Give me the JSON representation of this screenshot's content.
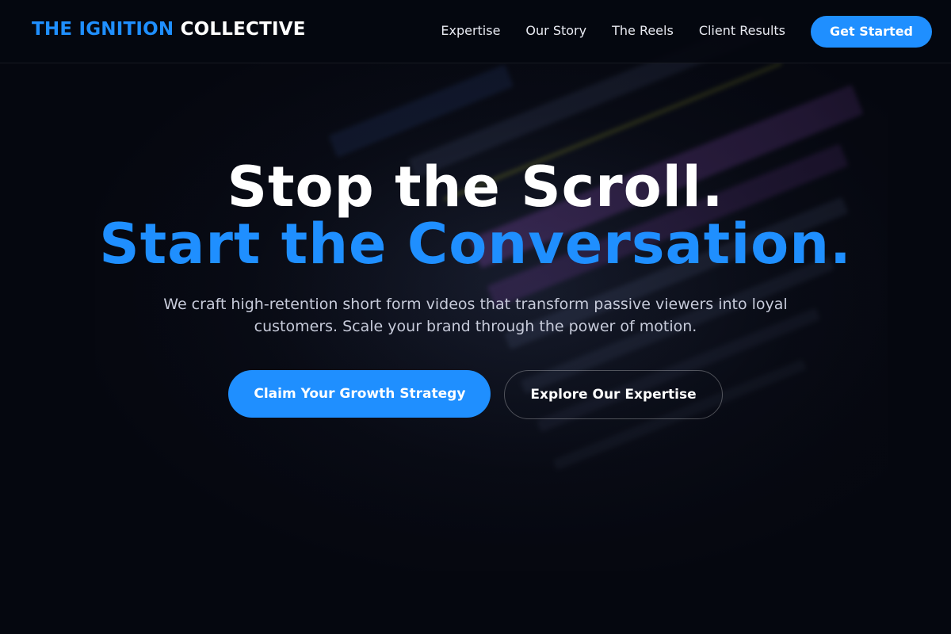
{
  "brand": {
    "part1": "THE IGNITION",
    "part2": "COLLECTIVE"
  },
  "nav": {
    "links": [
      "Expertise",
      "Our Story",
      "The Reels",
      "Client Results"
    ],
    "cta": "Get Started"
  },
  "hero": {
    "headline_line1": "Stop the Scroll.",
    "headline_line2": "Start the Conversation.",
    "subhead": "We craft high-retention short form videos that transform passive viewers into loyal customers. Scale your brand through the power of motion.",
    "primary_cta": "Claim Your Growth Strategy",
    "secondary_cta": "Explore Our Expertise"
  },
  "colors": {
    "accent": "#1f8fff",
    "background": "#05070f",
    "text": "#ffffff",
    "muted_text": "#c7cbda"
  }
}
